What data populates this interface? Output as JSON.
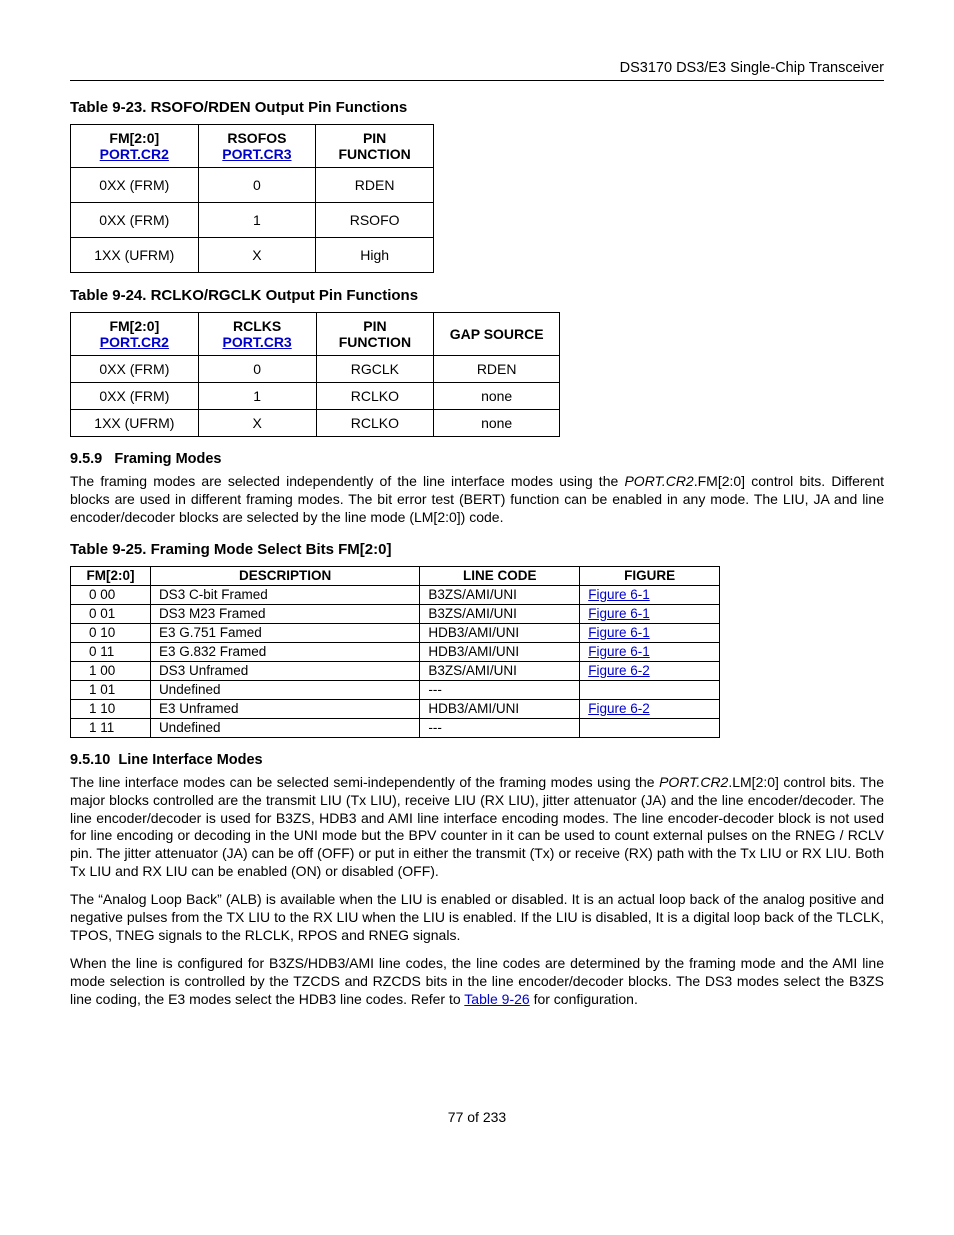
{
  "header": {
    "doc_title": "DS3170 DS3/E3 Single-Chip Transceiver"
  },
  "table23": {
    "caption": "Table 9-23. RSOFO/RDEN Output Pin Functions",
    "head": {
      "c1a": "FM[2:0]",
      "c1b": "PORT.CR2",
      "c2a": "RSOFOS",
      "c2b": "PORT.CR3",
      "c3a": "PIN",
      "c3b": "FUNCTION"
    },
    "rows": [
      {
        "c1": "0XX (FRM)",
        "c2": "0",
        "c3": "RDEN"
      },
      {
        "c1": "0XX (FRM)",
        "c2": "1",
        "c3": "RSOFO"
      },
      {
        "c1": "1XX (UFRM)",
        "c2": "X",
        "c3": "High"
      }
    ]
  },
  "table24": {
    "caption": "Table 9-24. RCLKO/RGCLK Output Pin Functions",
    "head": {
      "c1a": "FM[2:0]",
      "c1b": "PORT.CR2",
      "c2a": "RCLKS",
      "c2b": "PORT.CR3",
      "c3a": "PIN",
      "c3b": "FUNCTION",
      "c4": "GAP SOURCE"
    },
    "rows": [
      {
        "c1": "0XX (FRM)",
        "c2": "0",
        "c3": "RGCLK",
        "c4": "RDEN"
      },
      {
        "c1": "0XX (FRM)",
        "c2": "1",
        "c3": "RCLKO",
        "c4": "none"
      },
      {
        "c1": "1XX (UFRM)",
        "c2": "X",
        "c3": "RCLKO",
        "c4": "none"
      }
    ]
  },
  "section959": {
    "num": "9.5.9",
    "title": "Framing Modes",
    "p_before": "The framing modes are selected independently of the line interface modes using the ",
    "p_italic": "PORT.CR2",
    "p_after": ".FM[2:0] control bits. Different blocks are used in different framing modes. The bit error test (BERT) function can be enabled in any mode. The LIU, JA and line encoder/decoder blocks are selected by the line mode (LM[2:0]) code."
  },
  "table25": {
    "caption": "Table 9-25. Framing Mode Select Bits FM[2:0]",
    "head": {
      "c1": "FM[2:0]",
      "c2": "DESCRIPTION",
      "c3": "LINE CODE",
      "c4": "FIGURE"
    },
    "rows": [
      {
        "fm": "0 00",
        "desc": "DS3 C-bit Framed",
        "code": "B3ZS/AMI/UNI",
        "fig": "Figure 6-1"
      },
      {
        "fm": "0 01",
        "desc": "DS3 M23 Framed",
        "code": "B3ZS/AMI/UNI",
        "fig": "Figure 6-1"
      },
      {
        "fm": "0 10",
        "desc": "E3 G.751 Famed",
        "code": "HDB3/AMI/UNI",
        "fig": "Figure 6-1"
      },
      {
        "fm": "0 11",
        "desc": "E3 G.832 Framed",
        "code": "HDB3/AMI/UNI",
        "fig": "Figure 6-1"
      },
      {
        "fm": "1 00",
        "desc": "DS3 Unframed",
        "code": "B3ZS/AMI/UNI",
        "fig": "Figure 6-2"
      },
      {
        "fm": "1 01",
        "desc": "Undefined",
        "code": "---",
        "fig": ""
      },
      {
        "fm": "1 10",
        "desc": "E3 Unframed",
        "code": "HDB3/AMI/UNI",
        "fig": "Figure 6-2"
      },
      {
        "fm": "1 11",
        "desc": "Undefined",
        "code": "---",
        "fig": ""
      }
    ]
  },
  "section9510": {
    "num": "9.5.10",
    "title": "Line Interface Modes",
    "p1_before": "The line interface modes can be selected semi-independently of the framing modes using the ",
    "p1_italic": "PORT.CR2",
    "p1_after": ".LM[2:0] control bits. The major blocks controlled are the transmit LIU (Tx LIU), receive LIU (RX LIU), jitter attenuator (JA) and the line encoder/decoder. The line encoder/decoder is used for B3ZS, HDB3 and AMI line interface encoding modes.  The line encoder-decoder block is not used for line encoding or decoding in the UNI mode but the BPV counter in it can be used to count external pulses on the RNEG / RCLV pin.  The jitter attenuator (JA) can be off (OFF) or put in either the transmit (Tx) or receive (RX) path with the Tx LIU or RX LIU. Both Tx LIU and RX LIU can be enabled (ON) or disabled (OFF).",
    "p2": "The “Analog Loop Back” (ALB) is available when the LIU is enabled or disabled. It is an actual loop back of the analog positive and negative pulses from the TX LIU to the RX LIU when the LIU is enabled.  If the LIU is disabled, It is a digital loop back of the TLCLK, TPOS, TNEG signals to the RLCLK, RPOS and RNEG signals.",
    "p3_before": "When the line is configured for B3ZS/HDB3/AMI line codes, the line codes are determined by the framing mode and the AMI line mode selection is controlled by the TZCDS and RZCDS bits in the line encoder/decoder blocks. The DS3 modes select the B3ZS line coding, the E3 modes select the HDB3 line codes.  Refer to ",
    "p3_link": "Table 9-26",
    "p3_after": " for configuration."
  },
  "footer": {
    "page": "77 of 233"
  }
}
